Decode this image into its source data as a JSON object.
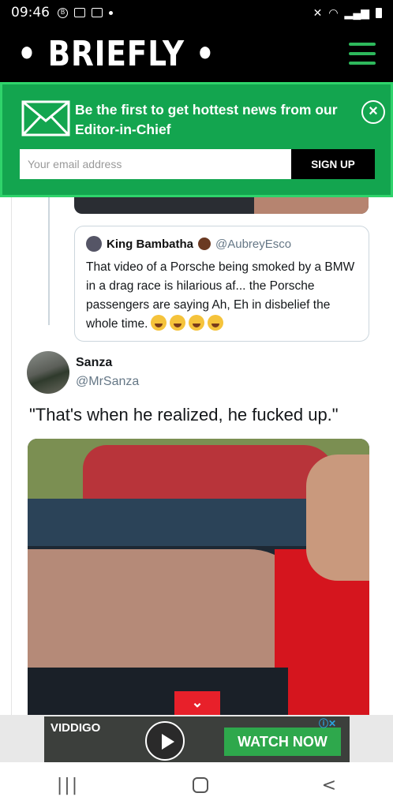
{
  "status_bar": {
    "time": "09:46",
    "left_icons": [
      "b-badge-icon",
      "image-icon",
      "video-icon",
      "dot-icon"
    ],
    "right_icons": [
      "mute-icon",
      "wifi-icon",
      "signal-icon",
      "battery-icon"
    ]
  },
  "header": {
    "logo": "• BRIEFLY •",
    "menu_icon": "hamburger-icon",
    "accent_color": "#2eb85c"
  },
  "newsletter": {
    "title": "Be the first to get hottest news from our Editor-in-Chief",
    "email_placeholder": "Your email address",
    "signup_label": "SIGN UP",
    "close_label": "×",
    "background_color": "#13a54f"
  },
  "quoted_tweet": {
    "name": "King Bambatha",
    "handle": "@AubreyEsco",
    "text": "That video of a Porsche being smoked by a BMW in a drag race is hilarious af... the Porsche passengers are saying Ah, Eh in disbelief the whole time."
  },
  "tweet": {
    "name": "Sanza",
    "handle": "@MrSanza",
    "text": "\"That's when he realized, he fucked up.\""
  },
  "scroll_button": {
    "icon": "chevron-down-icon",
    "label": "⌄",
    "color": "#e8202a"
  },
  "ad": {
    "brand": "VIDDIGO",
    "cta": "WATCH NOW",
    "close": "ⓘ✕"
  },
  "nav": {
    "recents": "|||",
    "back": "<"
  }
}
